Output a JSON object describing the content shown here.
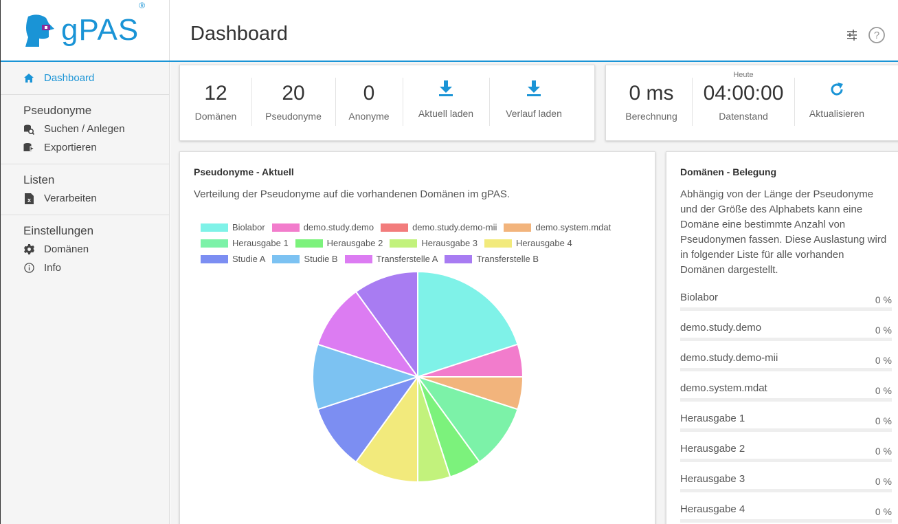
{
  "app": {
    "name": "gPAS",
    "reg": "®"
  },
  "header": {
    "title": "Dashboard",
    "icons": [
      "sliders-icon",
      "help-circle-icon"
    ]
  },
  "sidebar": {
    "dashboard": "Dashboard",
    "sections": [
      {
        "heading": "Pseudonyme",
        "items": [
          {
            "label": "Suchen / Anlegen",
            "icon": "search-database-icon"
          },
          {
            "label": "Exportieren",
            "icon": "export-database-icon"
          }
        ]
      },
      {
        "heading": "Listen",
        "items": [
          {
            "label": "Verarbeiten",
            "icon": "excel-file-icon"
          }
        ]
      },
      {
        "heading": "Einstellungen",
        "items": [
          {
            "label": "Domänen",
            "icon": "gear-icon"
          },
          {
            "label": "Info",
            "icon": "info-icon"
          }
        ]
      }
    ]
  },
  "stats": {
    "domaenen": {
      "value": "12",
      "label": "Domänen"
    },
    "pseudonyme": {
      "value": "20",
      "label": "Pseudonyme"
    },
    "anonyme": {
      "value": "0",
      "label": "Anonyme"
    },
    "aktuell_laden": "Aktuell laden",
    "verlauf_laden": "Verlauf laden",
    "berechnung": {
      "value": "0 ms",
      "label": "Berechnung"
    },
    "datenstand": {
      "heute": "Heute",
      "value": "04:00:00",
      "label": "Datenstand"
    },
    "aktualisieren": "Aktualisieren"
  },
  "pie_card": {
    "title": "Pseudonyme - Aktuell",
    "text": "Verteilung der Pseudonyme auf die vorhandenen Domänen im gPAS."
  },
  "belegung": {
    "title": "Domänen - Belegung",
    "text": "Abhängig von der Länge der Pseudonyme und der Größe des Alphabets kann eine Domäne eine bestimmte Anzahl von Pseudonymen fassen. Diese Auslastung wird in folgender Liste für alle vorhanden Domänen dargestellt.",
    "rows": [
      {
        "name": "Biolabor",
        "pct": "0 %"
      },
      {
        "name": "demo.study.demo",
        "pct": "0 %"
      },
      {
        "name": "demo.study.demo-mii",
        "pct": "0 %"
      },
      {
        "name": "demo.system.mdat",
        "pct": "0 %"
      },
      {
        "name": "Herausgabe 1",
        "pct": "0 %"
      },
      {
        "name": "Herausgabe 2",
        "pct": "0 %"
      },
      {
        "name": "Herausgabe 3",
        "pct": "0 %"
      },
      {
        "name": "Herausgabe 4",
        "pct": "0 %"
      }
    ]
  },
  "chart_data": {
    "type": "pie",
    "title": "",
    "categories": [
      "Biolabor",
      "demo.study.demo",
      "demo.study.demo-mii",
      "demo.system.mdat",
      "Herausgabe 1",
      "Herausgabe 2",
      "Herausgabe 3",
      "Herausgabe 4",
      "Studie A",
      "Studie B",
      "Transferstelle A",
      "Transferstelle B"
    ],
    "values": [
      4,
      1,
      0,
      1,
      2,
      1,
      1,
      2,
      2,
      2,
      2,
      2
    ],
    "colors": [
      "#7ff2e8",
      "#f27ccc",
      "#f27c7c",
      "#f2b47c",
      "#7cf2a8",
      "#7cf27c",
      "#c2f27c",
      "#f2ea7c",
      "#7c8ef2",
      "#7cc2f2",
      "#dc7cf2",
      "#a87cf2"
    ],
    "legend": "top"
  }
}
